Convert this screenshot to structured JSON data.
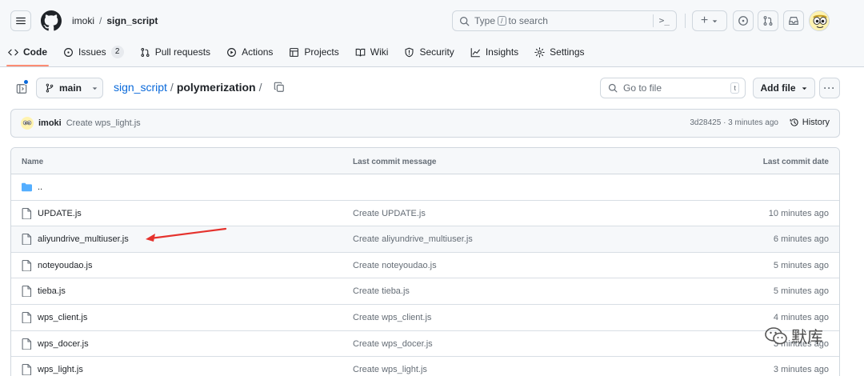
{
  "header": {
    "owner": "imoki",
    "separator": "/",
    "repo": "sign_script",
    "search": {
      "prefix": "Type",
      "key": "/",
      "suffix": "to search"
    },
    "command_glyph": ">_",
    "plus_glyph": "+",
    "icons": [
      "hamburger-icon",
      "github-logo",
      "search-icon",
      "terminal-icon",
      "plus-icon",
      "caret-down-icon",
      "issue-circle-icon",
      "pull-request-icon",
      "inbox-icon",
      "user-avatar"
    ]
  },
  "nav": {
    "items": [
      {
        "label": "Code",
        "icon": "code-icon",
        "active": true
      },
      {
        "label": "Issues",
        "icon": "issue-icon",
        "count": "2"
      },
      {
        "label": "Pull requests",
        "icon": "pull-request-icon"
      },
      {
        "label": "Actions",
        "icon": "play-icon"
      },
      {
        "label": "Projects",
        "icon": "table-icon"
      },
      {
        "label": "Wiki",
        "icon": "book-icon"
      },
      {
        "label": "Security",
        "icon": "shield-icon"
      },
      {
        "label": "Insights",
        "icon": "graph-icon"
      },
      {
        "label": "Settings",
        "icon": "gear-icon"
      }
    ],
    "accent_color": "#fd8c73"
  },
  "path_row": {
    "branch": "main",
    "repo_link": "sign_script",
    "separator": "/",
    "current_dir": "polymerization",
    "trailing_sep": "/",
    "goto_placeholder": "Go to file",
    "goto_key": "t",
    "add_file_label": "Add file",
    "more_glyph": "···"
  },
  "commit": {
    "author": "imoki",
    "message": "Create wps_light.js",
    "meta": "3d28425 · 3 minutes ago",
    "history_label": "History"
  },
  "table": {
    "headers": {
      "name": "Name",
      "message": "Last commit message",
      "date": "Last commit date"
    },
    "rows": [
      {
        "name": "..",
        "type": "folder",
        "message": "",
        "date": ""
      },
      {
        "name": "UPDATE.js",
        "type": "file",
        "message": "Create UPDATE.js",
        "date": "10 minutes ago"
      },
      {
        "name": "aliyundrive_multiuser.js",
        "type": "file",
        "message": "Create aliyundrive_multiuser.js",
        "date": "6 minutes ago",
        "highlighted": true
      },
      {
        "name": "noteyoudao.js",
        "type": "file",
        "message": "Create noteyoudao.js",
        "date": "5 minutes ago"
      },
      {
        "name": "tieba.js",
        "type": "file",
        "message": "Create tieba.js",
        "date": "5 minutes ago"
      },
      {
        "name": "wps_client.js",
        "type": "file",
        "message": "Create wps_client.js",
        "date": "4 minutes ago"
      },
      {
        "name": "wps_docer.js",
        "type": "file",
        "message": "Create wps_docer.js",
        "date": "3 minutes ago"
      },
      {
        "name": "wps_light.js",
        "type": "file",
        "message": "Create wps_light.js",
        "date": "3 minutes ago"
      }
    ]
  },
  "annotation": {
    "color": "#e5322d"
  },
  "watermark": {
    "text": "默库"
  },
  "colors": {
    "link": "#0969da",
    "folder": "#54aeff",
    "border": "#d0d7de",
    "muted": "#656d76"
  }
}
